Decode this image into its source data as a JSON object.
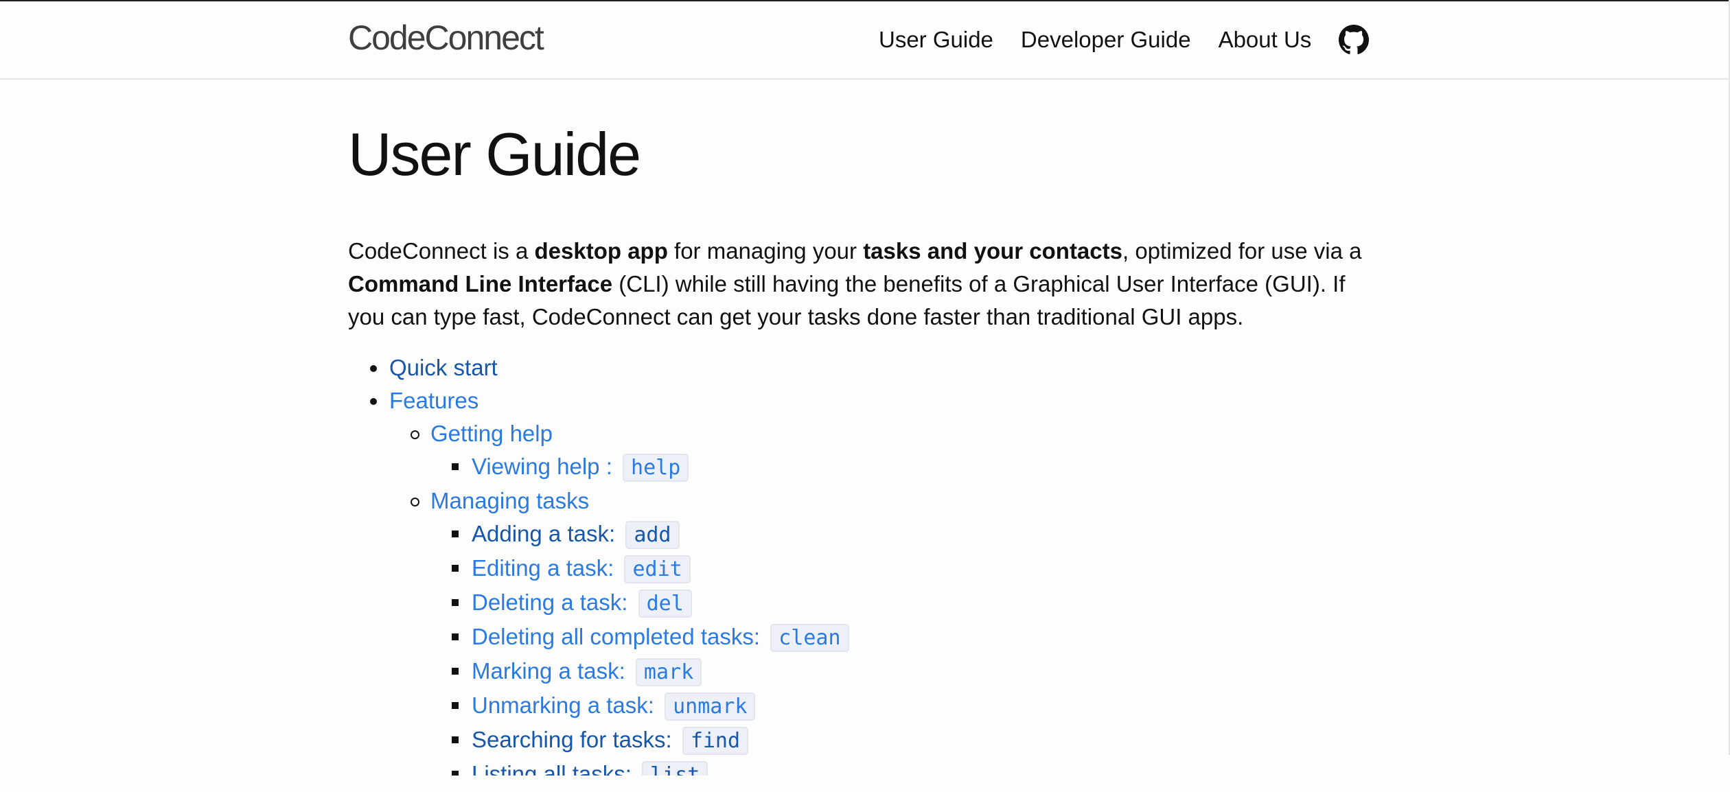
{
  "header": {
    "site_title": "CodeConnect",
    "nav": [
      {
        "label": "User Guide"
      },
      {
        "label": "Developer Guide"
      },
      {
        "label": "About Us"
      }
    ],
    "github_icon": "github-icon"
  },
  "main": {
    "title": "User Guide",
    "intro": {
      "p1": "CodeConnect is a ",
      "b1": "desktop app",
      "p2": " for managing your ",
      "b2": "tasks and your contacts",
      "p3": ", optimized for use via a ",
      "b3": "Command Line Interface",
      "p4": " (CLI) while still having the benefits of a Graphical User Interface (GUI). If you can type fast, CodeConnect can get your tasks done faster than traditional GUI apps."
    },
    "toc": {
      "quick_start": "Quick start",
      "features": "Features",
      "getting_help": "Getting help",
      "viewing_help": "Viewing help : ",
      "viewing_help_code": "help",
      "managing_tasks": "Managing tasks",
      "tasks": [
        {
          "label": "Adding a task: ",
          "code": "add"
        },
        {
          "label": "Editing a task: ",
          "code": "edit"
        },
        {
          "label": "Deleting a task: ",
          "code": "del"
        },
        {
          "label": "Deleting all completed tasks: ",
          "code": "clean"
        },
        {
          "label": "Marking a task: ",
          "code": "mark"
        },
        {
          "label": "Unmarking a task: ",
          "code": "unmark"
        },
        {
          "label": "Searching for tasks: ",
          "code": "find"
        },
        {
          "label": "Listing all tasks: ",
          "code": "list"
        }
      ]
    }
  },
  "colors": {
    "link": "#2a7ae2",
    "link_visited": "#1756a9",
    "text": "#111111",
    "code_bg": "#eef0f8"
  }
}
